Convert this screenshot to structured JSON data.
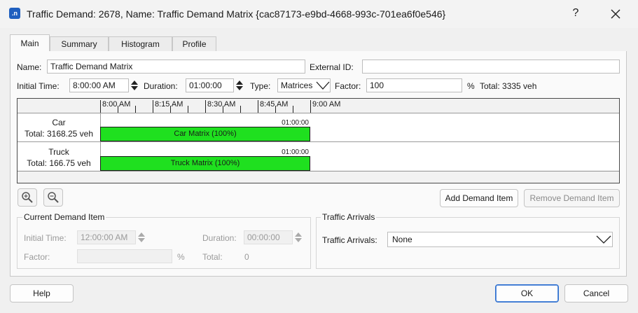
{
  "window": {
    "app_icon_text": ".n",
    "title": "Traffic Demand: 2678, Name: Traffic Demand Matrix  {cac87173-e9bd-4668-993c-701ea6f0e546}",
    "help_label": "?"
  },
  "tabs": [
    "Main",
    "Summary",
    "Histogram",
    "Profile"
  ],
  "main": {
    "name_label": "Name:",
    "name_value": "Traffic Demand Matrix",
    "external_id_label": "External ID:",
    "external_id_value": "",
    "initial_time_label": "Initial Time:",
    "initial_time_value": "8:00:00 AM",
    "duration_label": "Duration:",
    "duration_value": "01:00:00",
    "type_label": "Type:",
    "type_value": "Matrices",
    "factor_label": "Factor:",
    "factor_value": "100",
    "percent": "%",
    "total_text": "Total: 3335 veh"
  },
  "timeline": {
    "ticks": [
      "8:00 AM",
      "8:15 AM",
      "8:30 AM",
      "8:45 AM",
      "9:00 AM"
    ],
    "rows": [
      {
        "name": "Car",
        "total": "Total: 3168.25 veh",
        "duration": "01:00:00",
        "bar_label": "Car Matrix (100%)"
      },
      {
        "name": "Truck",
        "total": "Total: 166.75 veh",
        "duration": "01:00:00",
        "bar_label": "Truck Matrix (100%)"
      }
    ]
  },
  "actions": {
    "add": "Add Demand Item",
    "remove": "Remove Demand Item"
  },
  "current_item": {
    "title": "Current Demand Item",
    "initial_time_label": "Initial Time:",
    "initial_time_value": "12:00:00 AM",
    "duration_label": "Duration:",
    "duration_value": "00:00:00",
    "factor_label": "Factor:",
    "factor_value": "",
    "percent": "%",
    "total_label": "Total:",
    "total_value": "0"
  },
  "arrivals": {
    "title": "Traffic Arrivals",
    "label": "Traffic Arrivals:",
    "value": "None"
  },
  "footer": {
    "help": "Help",
    "ok": "OK",
    "cancel": "Cancel"
  },
  "colors": {
    "bar": "#1fe01f",
    "accent": "#2e6fcf"
  }
}
